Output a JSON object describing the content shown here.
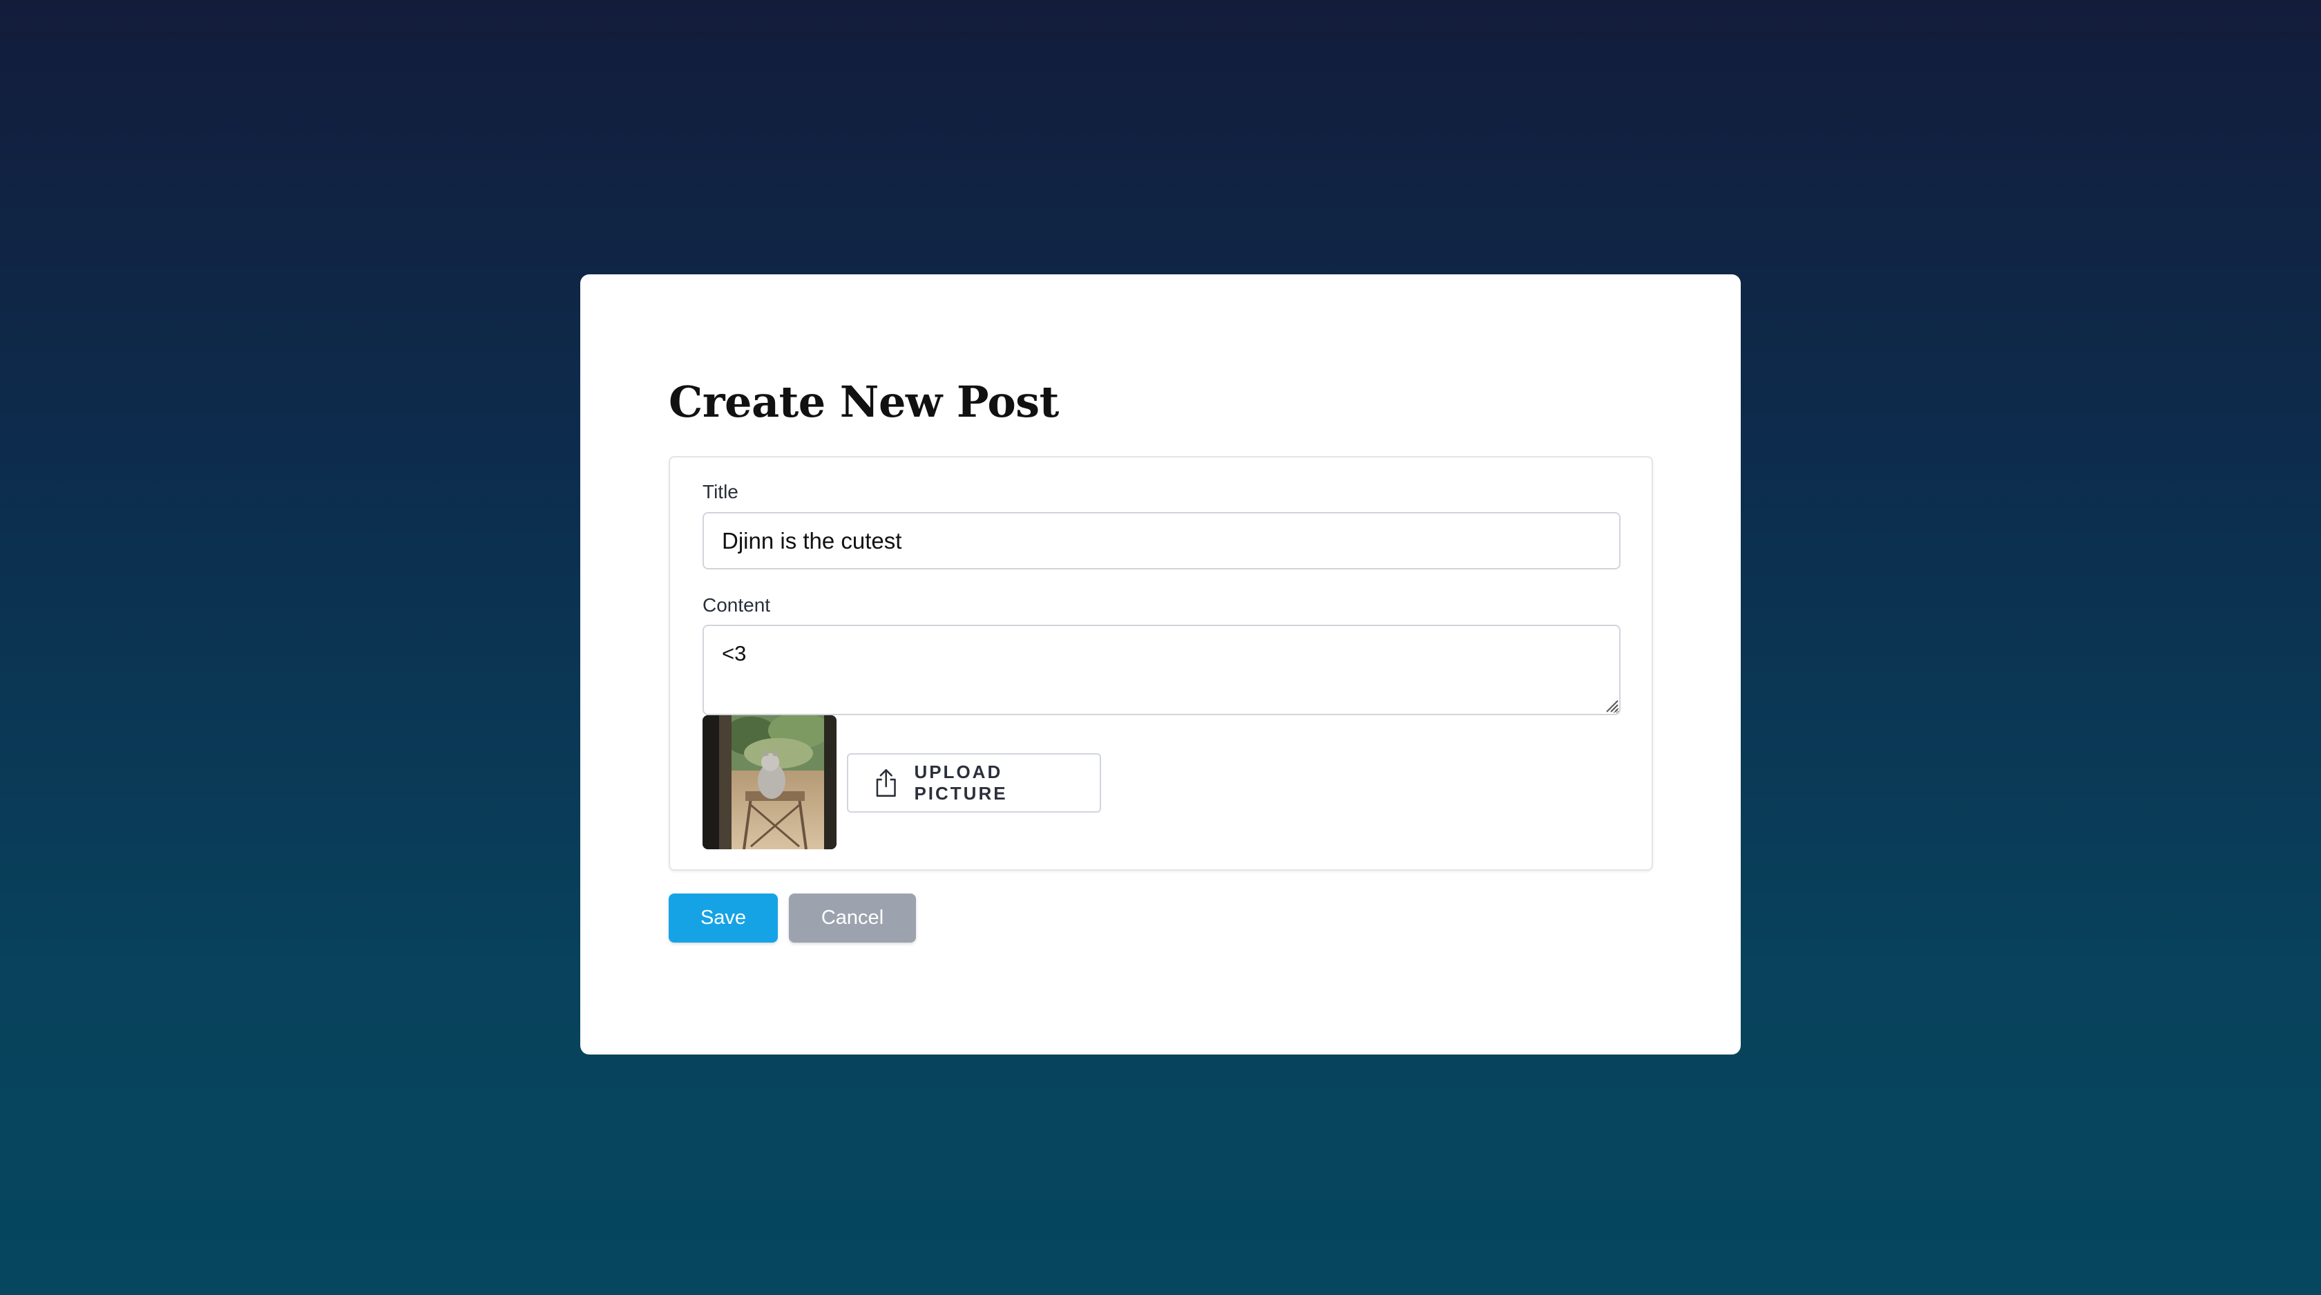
{
  "page": {
    "title": "Create New Post"
  },
  "form": {
    "title_label": "Title",
    "title_value": "Djinn is the cutest",
    "content_label": "Content",
    "content_value": "<3",
    "upload_label": "UPLOAD PICTURE",
    "upload_icon": "share-upload-icon"
  },
  "actions": {
    "save_label": "Save",
    "cancel_label": "Cancel"
  },
  "colors": {
    "save": "#16a3e6",
    "cancel": "#9ca3af",
    "background_top": "#131c3b",
    "background_bottom": "#06465e"
  }
}
